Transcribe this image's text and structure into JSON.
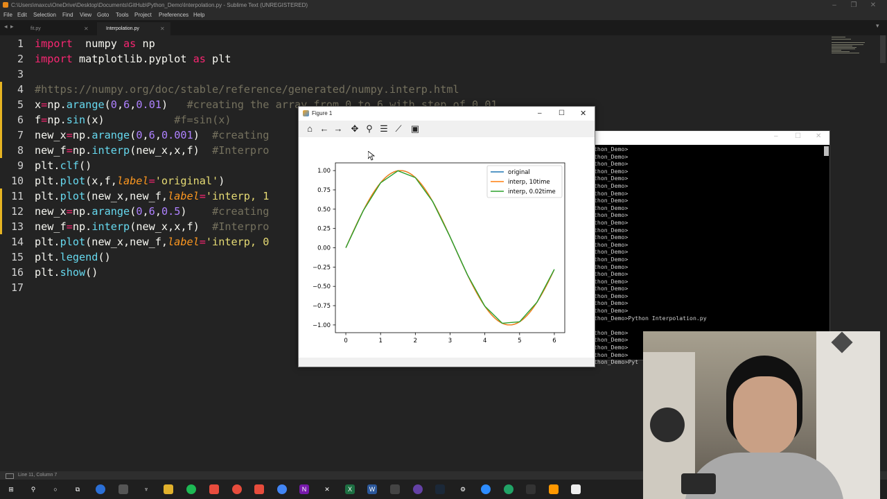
{
  "app": {
    "title": "C:\\Users\\maxcu\\OneDrive\\Desktop\\Documents\\GitHub\\Python_Demo\\Interpolation.py - Sublime Text (UNREGISTERED)",
    "menu": [
      "File",
      "Edit",
      "Selection",
      "Find",
      "View",
      "Goto",
      "Tools",
      "Project",
      "Preferences",
      "Help"
    ],
    "tabs": [
      {
        "label": "fit.py",
        "active": false
      },
      {
        "label": "Interpolation.py",
        "active": true
      }
    ],
    "status": "Line 11, Column 7"
  },
  "editor": {
    "line_numbers": [
      "1",
      "2",
      "3",
      "4",
      "5",
      "6",
      "7",
      "8",
      "9",
      "10",
      "11",
      "12",
      "13",
      "14",
      "15",
      "16",
      "17"
    ],
    "modified_lines": [
      4,
      5,
      6,
      7,
      8,
      11,
      12,
      13
    ],
    "lines": [
      [
        [
          "kw",
          "import"
        ],
        [
          "",
          "  numpy "
        ],
        [
          "kw",
          "as"
        ],
        [
          "",
          " np"
        ]
      ],
      [
        [
          "kw",
          "import"
        ],
        [
          "",
          " matplotlib.pyplot "
        ],
        [
          "kw",
          "as"
        ],
        [
          "",
          " plt"
        ]
      ],
      [],
      [
        [
          "cm",
          "#https://numpy.org/doc/stable/reference/generated/numpy.interp.html"
        ]
      ],
      [
        [
          "",
          "x"
        ],
        [
          "kw",
          "="
        ],
        [
          "",
          "np."
        ],
        [
          "fn",
          "arange"
        ],
        [
          "",
          "("
        ],
        [
          "num",
          "0"
        ],
        [
          "",
          ","
        ],
        [
          "num",
          "6"
        ],
        [
          "",
          ","
        ],
        [
          "num",
          "0.01"
        ],
        [
          "",
          ")   "
        ],
        [
          "cm",
          "#creating the array from 0 to 6 with step of 0.01"
        ]
      ],
      [
        [
          "",
          "f"
        ],
        [
          "kw",
          "="
        ],
        [
          "",
          "np."
        ],
        [
          "fn",
          "sin"
        ],
        [
          "",
          "(x)           "
        ],
        [
          "cm",
          "#f=sin(x)"
        ]
      ],
      [
        [
          "",
          "new_x"
        ],
        [
          "kw",
          "="
        ],
        [
          "",
          "np."
        ],
        [
          "fn",
          "arange"
        ],
        [
          "",
          "("
        ],
        [
          "num",
          "0"
        ],
        [
          "",
          ","
        ],
        [
          "num",
          "6"
        ],
        [
          "",
          ","
        ],
        [
          "num",
          "0.001"
        ],
        [
          "",
          ")  "
        ],
        [
          "cm",
          "#creating"
        ]
      ],
      [
        [
          "",
          "new_f"
        ],
        [
          "kw",
          "="
        ],
        [
          "",
          "np."
        ],
        [
          "fn",
          "interp"
        ],
        [
          "",
          "(new_x,x,f)  "
        ],
        [
          "cm",
          "#Interpro"
        ]
      ],
      [
        [
          "",
          "plt."
        ],
        [
          "fn",
          "clf"
        ],
        [
          "",
          "()"
        ]
      ],
      [
        [
          "",
          "plt."
        ],
        [
          "fn",
          "plot"
        ],
        [
          "",
          "(x,f,"
        ],
        [
          "arg",
          "label"
        ],
        [
          "kw",
          "="
        ],
        [
          "str",
          "'original'"
        ],
        [
          "",
          ")"
        ]
      ],
      [
        [
          "",
          "plt."
        ],
        [
          "fn",
          "plot"
        ],
        [
          "",
          "(new_x,new_f,"
        ],
        [
          "arg",
          "label"
        ],
        [
          "kw",
          "="
        ],
        [
          "str",
          "'interp, 1"
        ]
      ],
      [
        [
          "",
          "new_x"
        ],
        [
          "kw",
          "="
        ],
        [
          "",
          "np."
        ],
        [
          "fn",
          "arange"
        ],
        [
          "",
          "("
        ],
        [
          "num",
          "0"
        ],
        [
          "",
          ","
        ],
        [
          "num",
          "6"
        ],
        [
          "",
          ","
        ],
        [
          "num",
          "0.5"
        ],
        [
          "",
          ")    "
        ],
        [
          "cm",
          "#creating"
        ]
      ],
      [
        [
          "",
          "new_f"
        ],
        [
          "kw",
          "="
        ],
        [
          "",
          "np."
        ],
        [
          "fn",
          "interp"
        ],
        [
          "",
          "(new_x,x,f)  "
        ],
        [
          "cm",
          "#Interpro"
        ]
      ],
      [
        [
          "",
          "plt."
        ],
        [
          "fn",
          "plot"
        ],
        [
          "",
          "(new_x,new_f,"
        ],
        [
          "arg",
          "label"
        ],
        [
          "kw",
          "="
        ],
        [
          "str",
          "'interp, 0"
        ]
      ],
      [
        [
          "",
          "plt."
        ],
        [
          "fn",
          "legend"
        ],
        [
          "",
          "()"
        ]
      ],
      [
        [
          "",
          "plt."
        ],
        [
          "fn",
          "show"
        ],
        [
          "",
          "()"
        ]
      ],
      []
    ]
  },
  "console": {
    "lines": [
      "thon_Demo>",
      "thon_Demo>",
      "thon_Demo>",
      "thon_Demo>",
      "thon_Demo>",
      "thon_Demo>",
      "thon_Demo>",
      "thon_Demo>",
      "thon_Demo>",
      "thon_Demo>",
      "thon_Demo>",
      "thon_Demo>",
      "thon_Demo>",
      "thon_Demo>",
      "thon_Demo>",
      "thon_Demo>",
      "thon_Demo>",
      "thon_Demo>",
      "thon_Demo>",
      "thon_Demo>",
      "thon_Demo>",
      "thon_Demo>",
      "thon_Demo>",
      "thon_Demo>Python Interpolation.py",
      "",
      "thon_Demo>",
      "thon_Demo>",
      "thon_Demo>",
      "thon_Demo>",
      "thon_Demo>Pyt"
    ]
  },
  "figure": {
    "window_title": "Figure 1",
    "tools": [
      "home-icon",
      "back-arrow-icon",
      "forward-arrow-icon",
      "pan-icon",
      "zoom-icon",
      "subplots-icon",
      "edit-curve-icon",
      "save-icon"
    ]
  },
  "chart_data": {
    "type": "line",
    "xlim": [
      -0.3,
      6.3
    ],
    "ylim": [
      -1.1,
      1.1
    ],
    "xticks": [
      "0",
      "1",
      "2",
      "3",
      "4",
      "5",
      "6"
    ],
    "yticks": [
      "1.00",
      "0.75",
      "0.50",
      "0.25",
      "0.00",
      "−0.25",
      "−0.50",
      "−0.75",
      "−1.00"
    ],
    "ytick_values": [
      1.0,
      0.75,
      0.5,
      0.25,
      0.0,
      -0.25,
      -0.5,
      -0.75,
      -1.0
    ],
    "legend_position": "top-right",
    "grid": false,
    "series": [
      {
        "name": "original",
        "color": "#1f77b4",
        "func": "sin",
        "x_start": 0,
        "x_end": 5.99,
        "step": 0.01
      },
      {
        "name": "interp, 10time",
        "color": "#ff7f0e",
        "func": "sin",
        "x_start": 0,
        "x_end": 5.99,
        "step": 0.01
      },
      {
        "name": "interp, 0.02time",
        "color": "#2ca02c",
        "x": [
          0,
          0.5,
          1,
          1.5,
          2,
          2.5,
          3,
          3.5,
          4,
          4.5,
          5,
          5.5,
          6
        ],
        "y": [
          0,
          0.479,
          0.841,
          0.997,
          0.909,
          0.598,
          0.141,
          -0.351,
          -0.757,
          -0.978,
          -0.959,
          -0.706,
          -0.279
        ]
      }
    ]
  }
}
